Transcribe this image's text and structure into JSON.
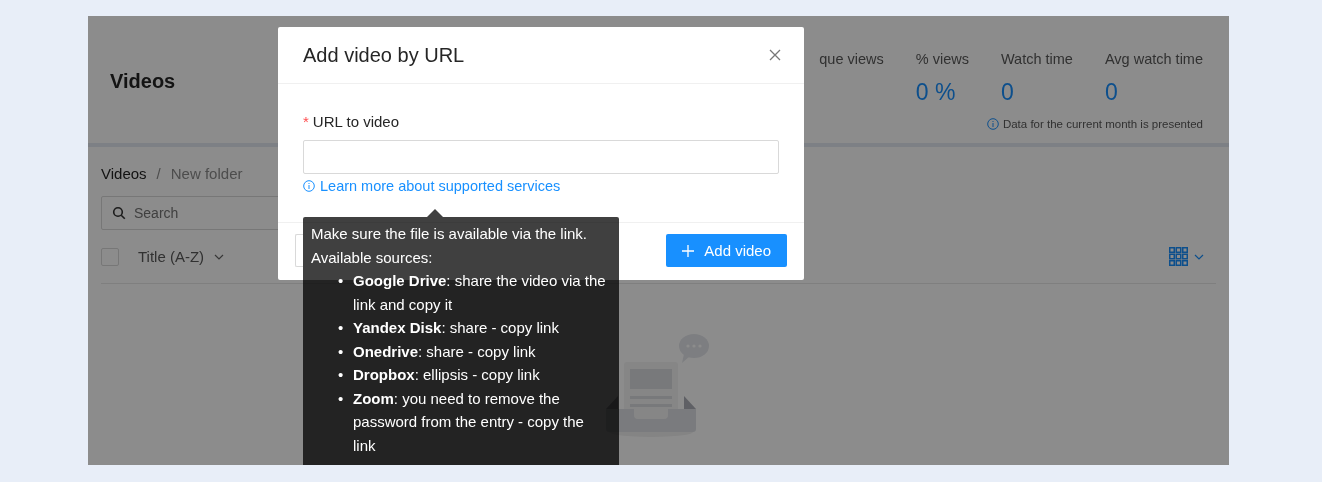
{
  "page": {
    "title": "Videos",
    "stats": [
      {
        "label": "que views"
      },
      {
        "label": "% views",
        "value": "0 %"
      },
      {
        "label": "Watch time",
        "value": "0"
      },
      {
        "label": "Avg watch time",
        "value": "0"
      }
    ],
    "stats_note": "Data for the current month is presented",
    "breadcrumb": [
      "Videos",
      "New folder"
    ],
    "breadcrumb_separator": "/",
    "search": {
      "placeholder": "Search"
    },
    "select_all": {
      "checked": false
    },
    "sort": "Title (A-Z)"
  },
  "modal": {
    "title": "Add video by URL",
    "field": {
      "label": "URL to video",
      "required": true,
      "required_mark": "*"
    },
    "help_link": "Learn more about supported services",
    "primary_button": "Add video"
  },
  "tooltip": {
    "bullet": "•",
    "intro": [
      "Make sure the file is available via the link.",
      "Available sources:"
    ],
    "sources": [
      "**Google Drive**: share the video via the link and copy it",
      "**Yandex Disk**: share - copy link",
      "**Onedrive**: share - copy link",
      "**Dropbox**: ellipsis - copy link",
      "**Zoom**: you need to remove the password from the entry - copy the link"
    ]
  }
}
